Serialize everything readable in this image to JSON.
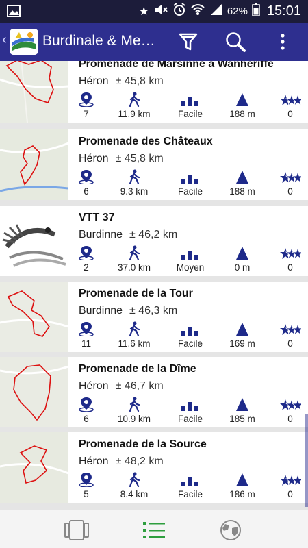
{
  "statusbar": {
    "battery_pct": "62%",
    "time": "15:01"
  },
  "actionbar": {
    "back": "‹",
    "title": "Burdinale & Me…",
    "colors": {
      "bar": "#2e2f8f",
      "accent": "#1e2a8a"
    }
  },
  "icons": {
    "poi": "map-pin-icon",
    "distance": "hiker-icon",
    "difficulty": "difficulty-bars-icon",
    "elevation": "mountain-icon",
    "rating": "stars-icon"
  },
  "items": [
    {
      "title": "Promenade de Marsinne à Wanhériffe",
      "place": "Héron",
      "dist": "± 45,8 km",
      "poi": "7",
      "km": "11.9 km",
      "diff": "Facile",
      "elev": "188 m",
      "rating": "0"
    },
    {
      "title": "Promenade des Châteaux",
      "place": "Héron",
      "dist": "± 45,8 km",
      "poi": "6",
      "km": "9.3 km",
      "diff": "Facile",
      "elev": "188 m",
      "rating": "0"
    },
    {
      "title": "VTT 37",
      "place": "Burdinne",
      "dist": "± 46,2 km",
      "poi": "2",
      "km": "37.0 km",
      "diff": "Moyen",
      "elev": "0 m",
      "rating": "0"
    },
    {
      "title": "Promenade de la Tour",
      "place": "Burdinne",
      "dist": "± 46,3 km",
      "poi": "11",
      "km": "11.6 km",
      "diff": "Facile",
      "elev": "169 m",
      "rating": "0"
    },
    {
      "title": "Promenade de la Dîme",
      "place": "Héron",
      "dist": "± 46,7 km",
      "poi": "6",
      "km": "10.9 km",
      "diff": "Facile",
      "elev": "185 m",
      "rating": "0"
    },
    {
      "title": "Promenade de la Source",
      "place": "Héron",
      "dist": "± 48,2 km",
      "poi": "5",
      "km": "8.4 km",
      "diff": "Facile",
      "elev": "186 m",
      "rating": "0"
    }
  ],
  "bottombar": {
    "tabs": [
      "cards-view-icon",
      "list-view-icon",
      "globe-map-icon"
    ],
    "active": "list-view-icon",
    "active_color": "#2e9e3e"
  }
}
